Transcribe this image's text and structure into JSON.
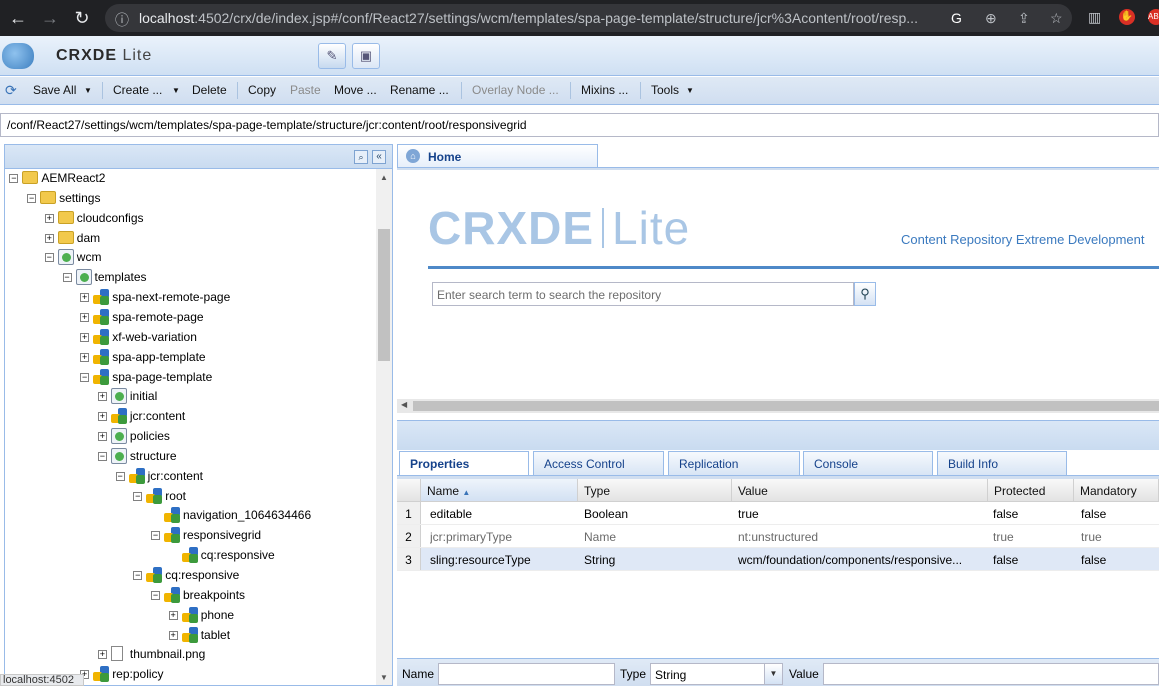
{
  "browser": {
    "url_host": "localhost",
    "url_rest": ":4502/crx/de/index.jsp#/conf/React27/settings/wcm/templates/spa-page-template/structure/jcr%3Acontent/root/resp..."
  },
  "app": {
    "logo_main": "CRXDE",
    "logo_sub": "Lite"
  },
  "toolbar": {
    "save_all": "Save All",
    "create": "Create ...",
    "delete": "Delete",
    "copy": "Copy",
    "paste": "Paste",
    "move": "Move ...",
    "rename": "Rename ...",
    "overlay_node": "Overlay Node ...",
    "mixins": "Mixins ...",
    "tools": "Tools"
  },
  "path": "/conf/React27/settings/wcm/templates/spa-page-template/structure/jcr:content/root/responsivegrid",
  "tree": [
    {
      "label": "AEMReact2",
      "type": "folder",
      "toggle": "-"
    },
    {
      "label": "settings",
      "type": "folder",
      "toggle": "-"
    },
    {
      "label": "cloudconfigs",
      "type": "folder",
      "toggle": "+"
    },
    {
      "label": "dam",
      "type": "folder",
      "toggle": "+"
    },
    {
      "label": "wcm",
      "type": "page",
      "toggle": "-"
    },
    {
      "label": "templates",
      "type": "page",
      "toggle": "-"
    },
    {
      "label": "spa-next-remote-page",
      "type": "node",
      "toggle": "+"
    },
    {
      "label": "spa-remote-page",
      "type": "node",
      "toggle": "+"
    },
    {
      "label": "xf-web-variation",
      "type": "node",
      "toggle": "+"
    },
    {
      "label": "spa-app-template",
      "type": "node",
      "toggle": "+"
    },
    {
      "label": "spa-page-template",
      "type": "node",
      "toggle": "-"
    },
    {
      "label": "initial",
      "type": "page",
      "toggle": "+"
    },
    {
      "label": "jcr:content",
      "type": "node",
      "toggle": "+"
    },
    {
      "label": "policies",
      "type": "page",
      "toggle": "+"
    },
    {
      "label": "structure",
      "type": "page",
      "toggle": "-"
    },
    {
      "label": "jcr:content",
      "type": "node",
      "toggle": "-"
    },
    {
      "label": "root",
      "type": "node",
      "toggle": "-"
    },
    {
      "label": "navigation_1064634466",
      "type": "node",
      "toggle": ""
    },
    {
      "label": "responsivegrid",
      "type": "node",
      "toggle": "-"
    },
    {
      "label": "cq:responsive",
      "type": "node",
      "toggle": ""
    },
    {
      "label": "cq:responsive",
      "type": "node",
      "toggle": "-"
    },
    {
      "label": "breakpoints",
      "type": "node",
      "toggle": "-"
    },
    {
      "label": "phone",
      "type": "node",
      "toggle": "+"
    },
    {
      "label": "tablet",
      "type": "node",
      "toggle": "+"
    },
    {
      "label": "thumbnail.png",
      "type": "file",
      "toggle": "+"
    },
    {
      "label": "rep:policy",
      "type": "node",
      "toggle": "+"
    }
  ],
  "home_tab": "Home",
  "welcome": {
    "logo_main": "CRXDE",
    "logo_sub": "Lite",
    "tagline": "Content Repository Extreme Development",
    "search_placeholder": "Enter search term to search the repository"
  },
  "bottom_tabs": [
    "Properties",
    "Access Control",
    "Replication",
    "Console",
    "Build Info"
  ],
  "grid": {
    "columns": [
      "Name",
      "Type",
      "Value",
      "Protected",
      "Mandatory"
    ],
    "rows": [
      {
        "n": "1",
        "name": "editable",
        "type": "Boolean",
        "value": "true",
        "protected": "false",
        "mandatory": "false"
      },
      {
        "n": "2",
        "name": "jcr:primaryType",
        "type": "Name",
        "value": "nt:unstructured",
        "protected": "true",
        "mandatory": "true"
      },
      {
        "n": "3",
        "name": "sling:resourceType",
        "type": "String",
        "value": "wcm/foundation/components/responsive...",
        "protected": "false",
        "mandatory": "false"
      }
    ]
  },
  "editbar": {
    "name_label": "Name",
    "type_label": "Type",
    "type_value": "String",
    "value_label": "Value"
  },
  "status": "localhost:4502"
}
